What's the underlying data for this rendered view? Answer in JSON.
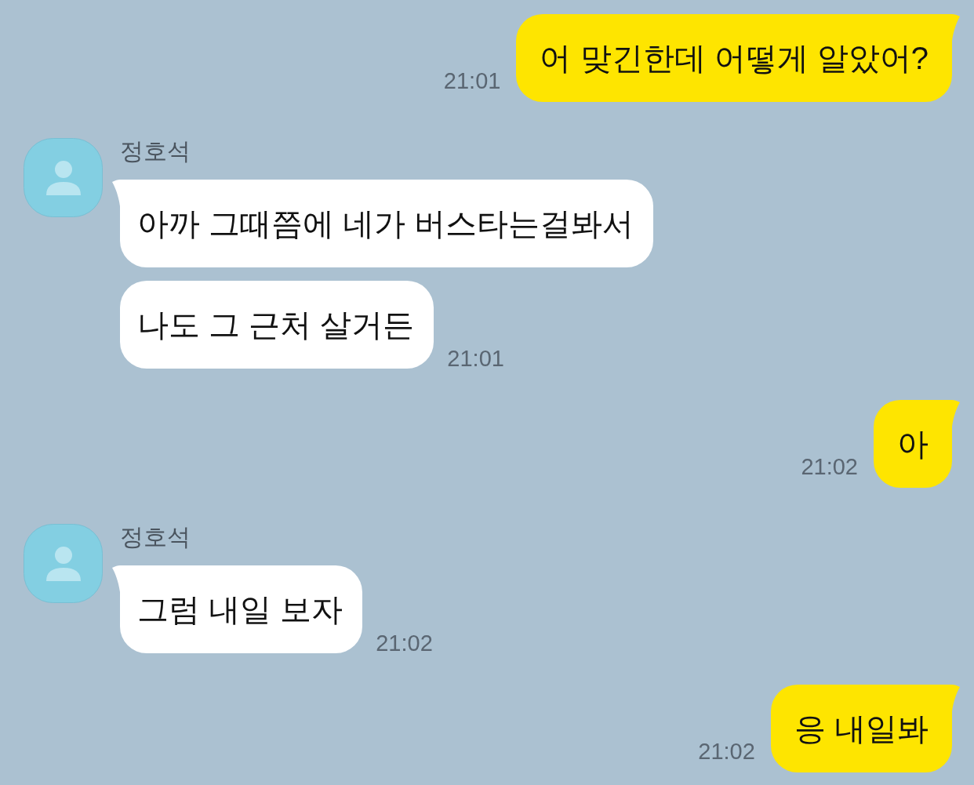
{
  "messages": [
    {
      "kind": "outgoing",
      "bubbles": [
        "어 맞긴한데 어떻게 알았어?"
      ],
      "time": "21:01"
    },
    {
      "kind": "incoming",
      "sender": "정호석",
      "bubbles": [
        "아까 그때쯤에 네가 버스타는걸봐서",
        "나도 그 근처 살거든"
      ],
      "time": "21:01"
    },
    {
      "kind": "outgoing",
      "bubbles": [
        "아"
      ],
      "time": "21:02"
    },
    {
      "kind": "incoming",
      "sender": "정호석",
      "bubbles": [
        "그럼 내일 보자"
      ],
      "time": "21:02"
    },
    {
      "kind": "outgoing",
      "bubbles": [
        "응 내일봐"
      ],
      "time": "21:02"
    }
  ]
}
